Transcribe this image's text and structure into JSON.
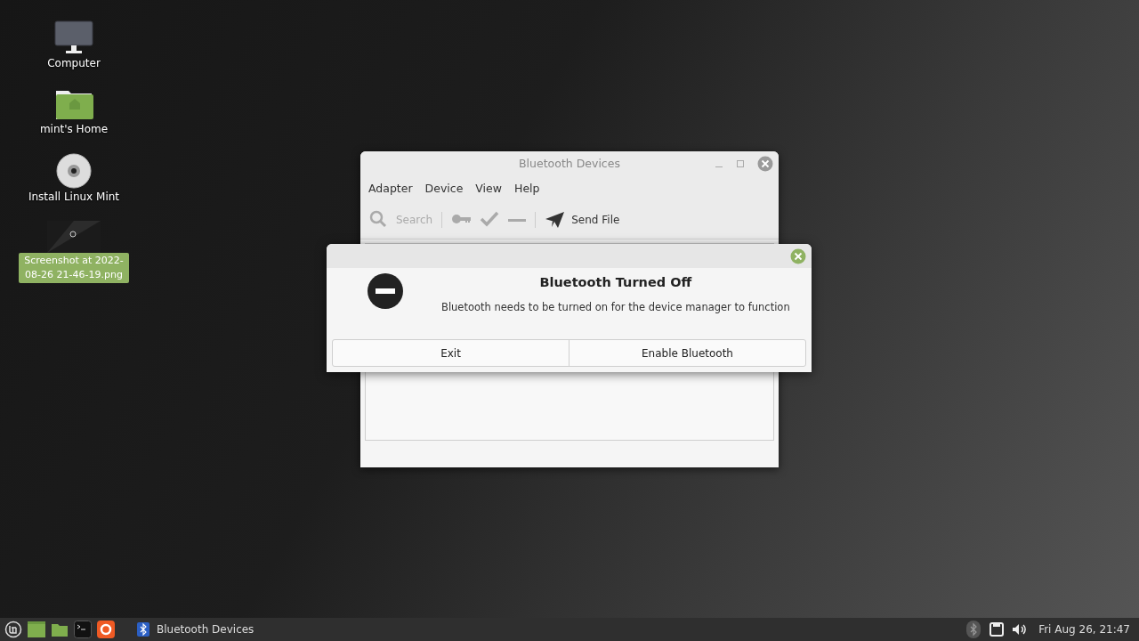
{
  "desktop_icons": [
    {
      "kind": "computer",
      "label": "Computer",
      "selected": false
    },
    {
      "kind": "home",
      "label": "mint's Home",
      "selected": false
    },
    {
      "kind": "disc",
      "label": "Install Linux Mint",
      "selected": false
    },
    {
      "kind": "image",
      "label": "Screenshot at 2022-08-26 21-46-19.png",
      "selected": true
    }
  ],
  "window": {
    "title": "Bluetooth Devices",
    "menu": [
      "Adapter",
      "Device",
      "View",
      "Help"
    ],
    "toolbar": [
      {
        "kind": "search",
        "label": "Search",
        "disabled": true
      },
      {
        "kind": "separator"
      },
      {
        "kind": "key",
        "disabled": true
      },
      {
        "kind": "check",
        "disabled": true
      },
      {
        "kind": "minus",
        "disabled": true
      },
      {
        "kind": "separator"
      },
      {
        "kind": "send",
        "label": "Send File",
        "disabled": false
      }
    ]
  },
  "dialog": {
    "title": "Bluetooth Turned Off",
    "message": "Bluetooth needs to be turned on for the device manager to function",
    "buttons": [
      "Exit",
      "Enable Bluetooth"
    ]
  },
  "taskbar": {
    "launchers": [
      {
        "kind": "menu"
      },
      {
        "kind": "desktop"
      },
      {
        "kind": "files"
      },
      {
        "kind": "terminal"
      },
      {
        "kind": "firefox"
      }
    ],
    "tasks": [
      {
        "label": "Bluetooth Devices",
        "selected": false
      }
    ],
    "tray": [
      {
        "kind": "bluetooth"
      },
      {
        "kind": "network"
      },
      {
        "kind": "volume"
      }
    ],
    "clock": "Fri Aug 26, 21:47"
  }
}
